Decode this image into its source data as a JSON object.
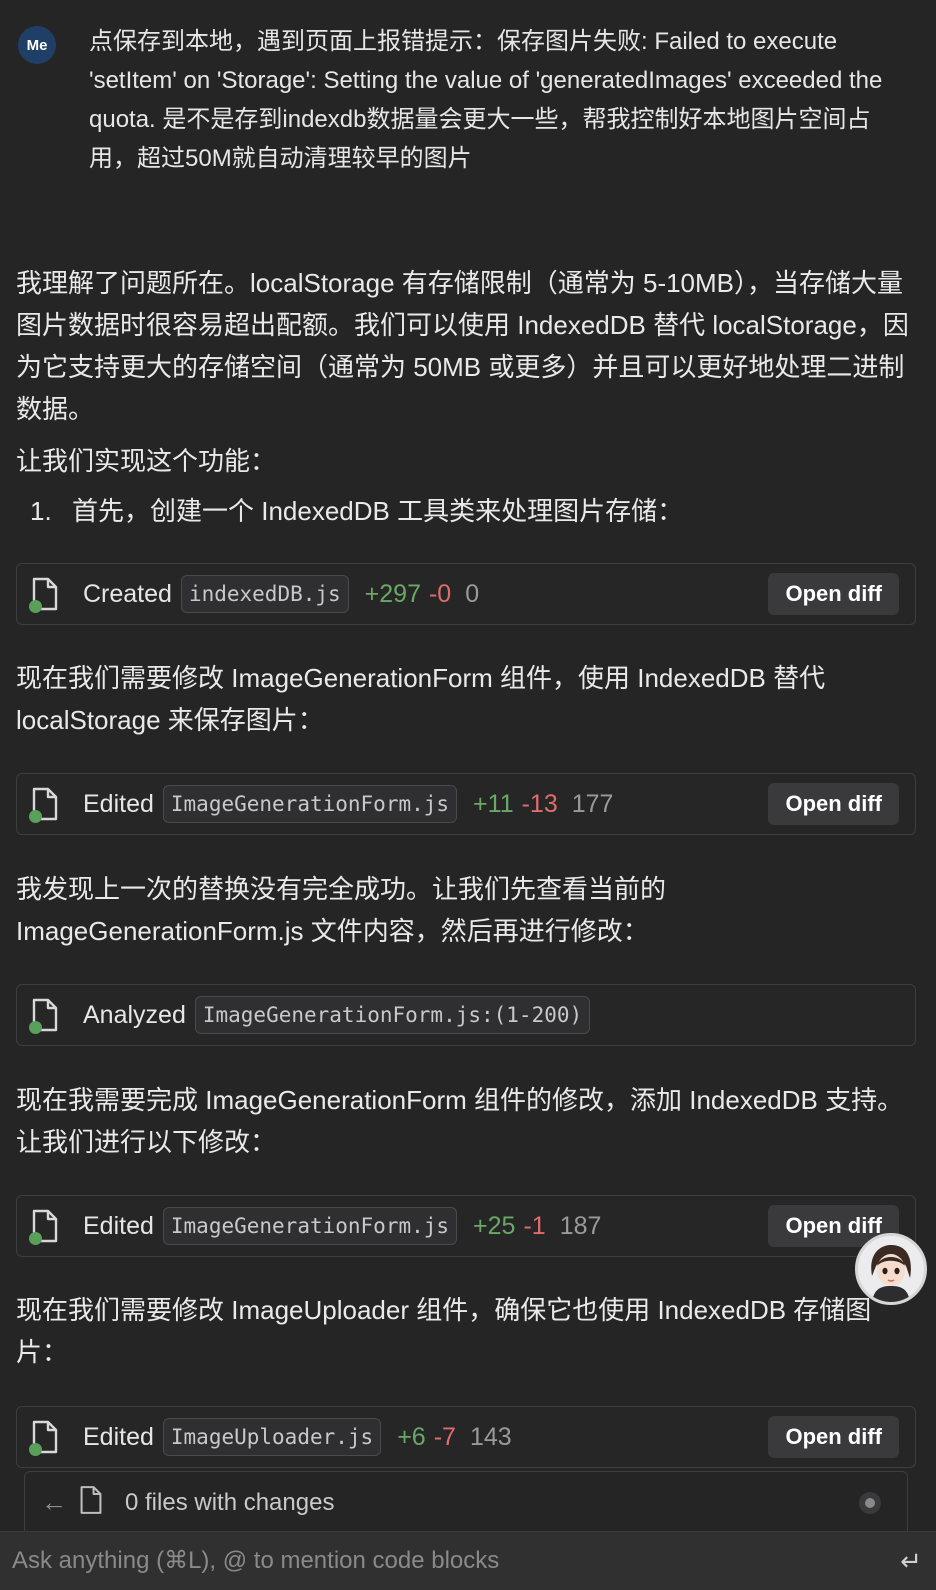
{
  "user_message": {
    "avatar": "Me",
    "text": "点保存到本地，遇到页面上报错提示：保存图片失败: Failed to execute 'setItem' on 'Storage': Setting the value of 'generatedImages' exceeded the quota. 是不是存到indexdb数据量会更大一些，帮我控制好本地图片空间占用，超过50M就自动清理较早的图片"
  },
  "paragraphs": {
    "p1": "我理解了问题所在。localStorage 有存储限制（通常为 5-10MB），当存储大量图片数据时很容易超出配额。我们可以使用 IndexedDB 替代 localStorage，因为它支持更大的存储空间（通常为 50MB 或更多）并且可以更好地处理二进制数据。",
    "p2": "让我们实现这个功能：",
    "list_num": "1.",
    "list_text": "首先，创建一个 IndexedDB 工具类来处理图片存储：",
    "p3": "现在我们需要修改 ImageGenerationForm 组件，使用 IndexedDB 替代 localStorage 来保存图片：",
    "p4": "我发现上一次的替换没有完全成功。让我们先查看当前的 ImageGenerationForm.js 文件内容，然后再进行修改：",
    "p5": "现在我需要完成 ImageGenerationForm 组件的修改，添加 IndexedDB 支持。让我们进行以下修改：",
    "p6": "现在我们需要修改 ImageUploader 组件，确保它也使用 IndexedDB 存储图片："
  },
  "cards": [
    {
      "action": "Created",
      "file": "indexedDB.js",
      "added": "+297",
      "removed": "-0",
      "total": "0",
      "button": "Open diff"
    },
    {
      "action": "Edited",
      "file": "ImageGenerationForm.js",
      "added": "+11",
      "removed": "-13",
      "total": "177",
      "button": "Open diff"
    },
    {
      "action": "Analyzed",
      "file": "ImageGenerationForm.js:(1-200)"
    },
    {
      "action": "Edited",
      "file": "ImageGenerationForm.js",
      "added": "+25",
      "removed": "-1",
      "total": "187",
      "button": "Open diff"
    },
    {
      "action": "Edited",
      "file": "ImageUploader.js",
      "added": "+6",
      "removed": "-7",
      "total": "143",
      "button": "Open diff"
    }
  ],
  "files_bar": {
    "label": "0 files with changes"
  },
  "input": {
    "placeholder": "Ask anything (⌘L), @ to mention code blocks",
    "enter_glyph": "↵"
  },
  "colors": {
    "background": "#252526",
    "added": "#6aa865",
    "removed": "#e06c6c",
    "avatar": "#1f3f66"
  }
}
